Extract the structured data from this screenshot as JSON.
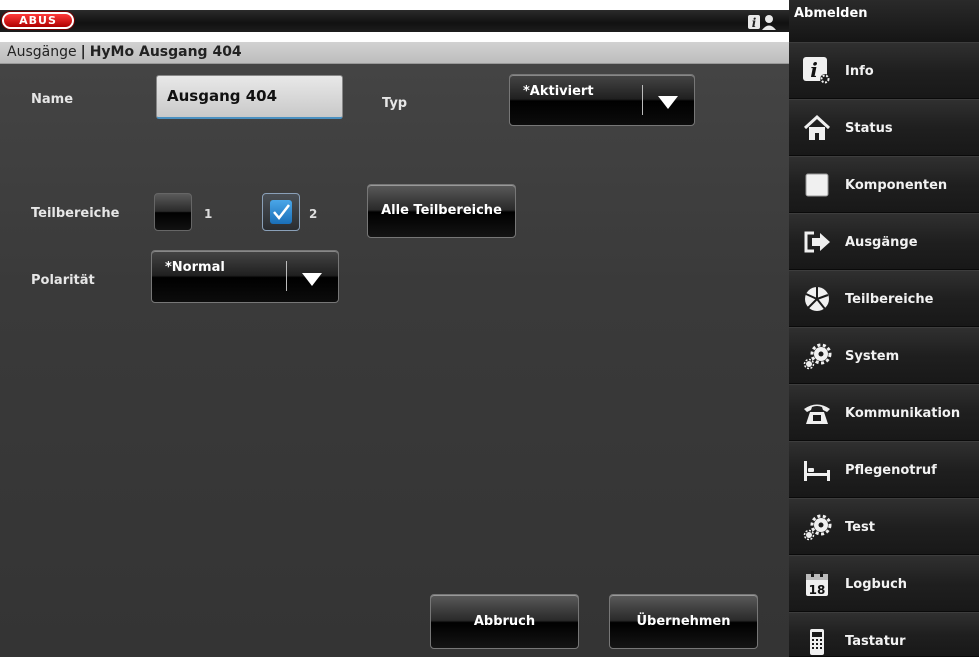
{
  "header": {
    "logo_text": "ABUS",
    "help_icon": "help-user-icon",
    "logout_label": "Abmelden"
  },
  "breadcrumb": {
    "section": "Ausgänge",
    "separator": "|",
    "current": "HyMo Ausgang 404"
  },
  "form": {
    "name_label": "Name",
    "name_value": "Ausgang 404",
    "type_label": "Typ",
    "type_value": "*Aktiviert",
    "areas_label": "Teilbereiche",
    "areas": [
      {
        "number": "1",
        "checked": false
      },
      {
        "number": "2",
        "checked": true
      }
    ],
    "all_areas_button": "Alle Teilbereiche",
    "polarity_label": "Polarität",
    "polarity_value": "*Normal"
  },
  "actions": {
    "cancel": "Abbruch",
    "apply": "Übernehmen"
  },
  "sidebar": {
    "items": [
      {
        "label": "Info",
        "icon": "info-settings-icon"
      },
      {
        "label": "Status",
        "icon": "home-icon"
      },
      {
        "label": "Komponenten",
        "icon": "square-icon"
      },
      {
        "label": "Ausgänge",
        "icon": "output-arrow-icon"
      },
      {
        "label": "Teilbereiche",
        "icon": "pie-sectors-icon"
      },
      {
        "label": "System",
        "icon": "gears-icon"
      },
      {
        "label": "Kommunikation",
        "icon": "telephone-icon"
      },
      {
        "label": "Pflegenotruf",
        "icon": "bed-icon"
      },
      {
        "label": "Test",
        "icon": "gears-icon"
      },
      {
        "label": "Logbuch",
        "icon": "calendar-icon"
      },
      {
        "label": "Tastatur",
        "icon": "keypad-icon"
      }
    ],
    "logbuch_day": "18"
  },
  "colors": {
    "accent": "#1a7fd0",
    "logo_red": "#d40000",
    "panel_bg": "#3c3c3c"
  }
}
